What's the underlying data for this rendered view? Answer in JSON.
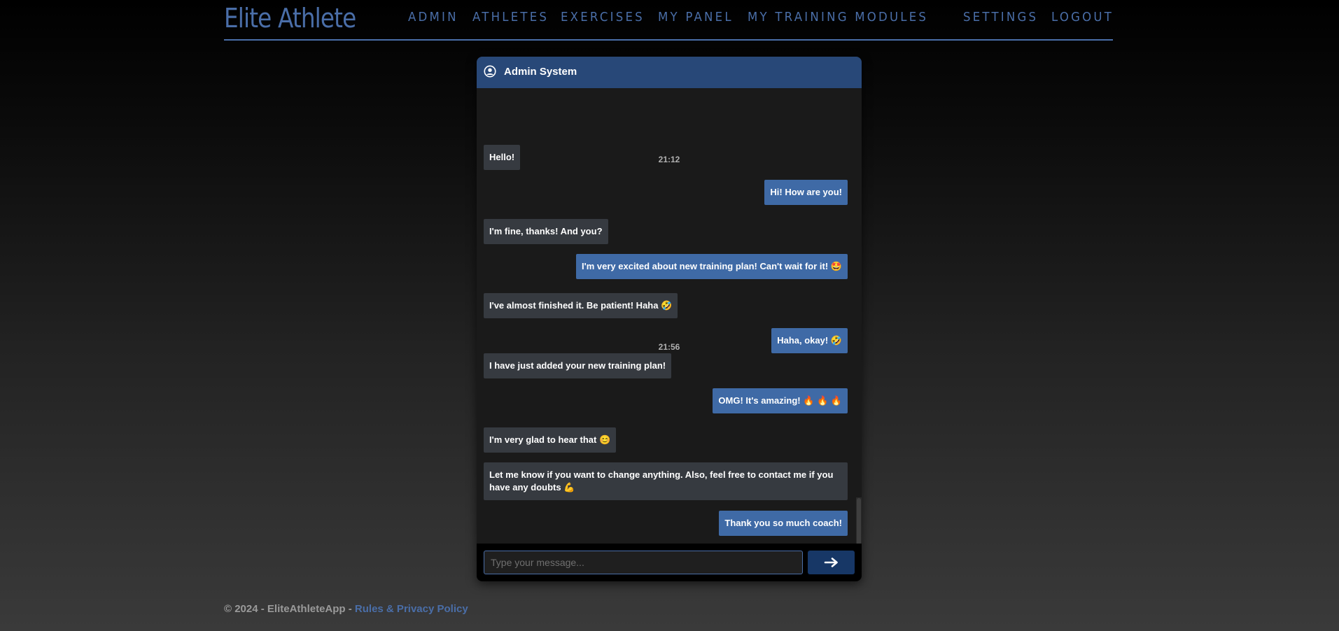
{
  "brand": "Elite Athlete",
  "nav": {
    "admin": "ADMIN",
    "athletes": "ATHLETES",
    "exercises": "EXERCISES",
    "my_panel": "MY PANEL",
    "my_training_modules": "MY TRAINING MODULES",
    "settings": "SETTINGS",
    "logout": "LOGOUT"
  },
  "chat": {
    "header_title": "Admin System",
    "header_icon": "user-circle-icon",
    "timestamps": [
      "21:12",
      "21:56"
    ],
    "messages": [
      {
        "direction": "incoming",
        "text": "Hello!"
      },
      {
        "direction": "outgoing",
        "text": "Hi! How are you!"
      },
      {
        "direction": "incoming",
        "text": "I'm fine, thanks! And you?"
      },
      {
        "direction": "outgoing",
        "text": "I'm very excited about new training plan! Can't wait for it! 🤩"
      },
      {
        "direction": "incoming",
        "text": "I've almost finished it. Be patient! Haha 🤣"
      },
      {
        "direction": "outgoing",
        "text": "Haha, okay! 🤣"
      },
      {
        "direction": "incoming",
        "text": "I have just added your new training plan!"
      },
      {
        "direction": "outgoing",
        "text": "OMG! It's amazing! 🔥 🔥 🔥"
      },
      {
        "direction": "incoming",
        "text": "I'm very glad to hear that 😊"
      },
      {
        "direction": "incoming",
        "text": "Let me know if you want to change anything. Also, feel free to contact me if you have any doubts 💪"
      },
      {
        "direction": "outgoing",
        "text": "Thank you so much coach!"
      }
    ],
    "input_placeholder": "Type your message...",
    "send_icon": "arrow-right-icon"
  },
  "footer": {
    "copyright": "© 2024 - EliteAthleteApp - ",
    "link": "Rules & Privacy Policy"
  },
  "colors": {
    "accent": "#4a6ea8",
    "header_bg": "#284878",
    "outgoing_bubble": "#3f6aa6",
    "incoming_bubble": "#363a40",
    "send_button": "#173766"
  }
}
